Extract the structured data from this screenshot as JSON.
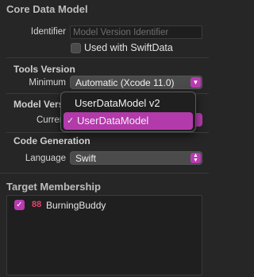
{
  "core_data": {
    "title": "Core Data Model",
    "identifier_label": "Identifier",
    "identifier_placeholder": "Model Version Identifier",
    "swiftdata_label": "Used with SwiftData"
  },
  "tools_version": {
    "title": "Tools Version",
    "minimum_label": "Minimum",
    "minimum_value": "Automatic (Xcode 11.0)"
  },
  "model_version": {
    "title": "Model Version",
    "current_label": "Current",
    "menu": {
      "items": [
        {
          "label": "UserDataModel v2",
          "selected": false
        },
        {
          "label": "UserDataModel",
          "selected": true
        }
      ],
      "check_glyph": "✓"
    }
  },
  "code_generation": {
    "title": "Code Generation",
    "language_label": "Language",
    "language_value": "Swift"
  },
  "target_membership": {
    "title": "Target Membership",
    "targets": [
      {
        "name": "BurningBuddy",
        "checked": true
      }
    ]
  },
  "colors": {
    "accent": "#b83bb0",
    "background": "#262626"
  }
}
